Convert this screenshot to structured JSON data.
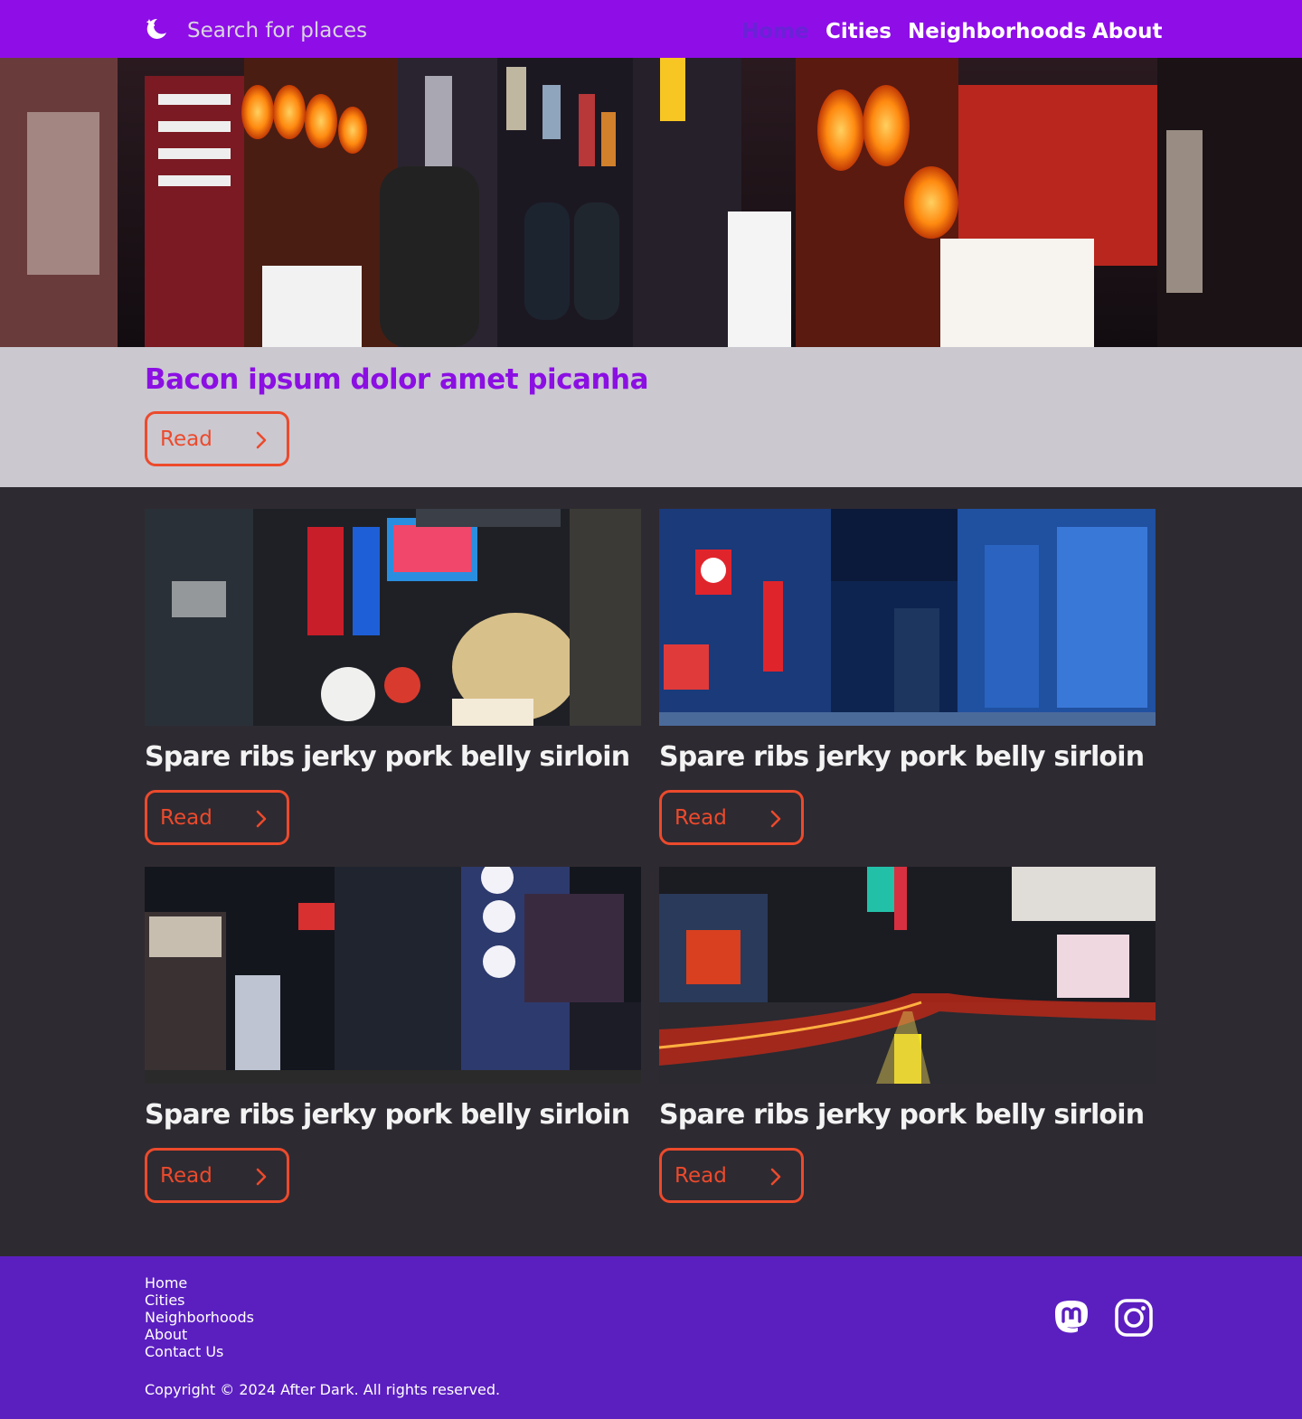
{
  "nav": {
    "search_placeholder": "Search for places",
    "links": [
      "Home",
      "Cities",
      "Neighborhoods",
      "About"
    ]
  },
  "hero": {
    "title": "Bacon ipsum dolor amet picanha",
    "button_label": "Read"
  },
  "cards": [
    {
      "title": "Spare ribs jerky pork belly sirloin",
      "button_label": "Read"
    },
    {
      "title": "Spare ribs jerky pork belly sirloin",
      "button_label": "Read"
    },
    {
      "title": "Spare ribs jerky pork belly sirloin",
      "button_label": "Read"
    },
    {
      "title": "Spare ribs jerky pork belly sirloin",
      "button_label": "Read"
    }
  ],
  "footer": {
    "links": [
      "Home",
      "Cities",
      "Neighborhoods",
      "About",
      "Contact Us"
    ],
    "copyright": "Copyright © 2024 After Dark. All rights reserved.",
    "social": [
      "mastodon-icon",
      "instagram-icon"
    ]
  },
  "colors": {
    "nav_bg": "#8f0ee8",
    "accent_orange": "#ec4a2c",
    "hero_title": "#8b0fe3",
    "page_bg": "#2e2a31",
    "footer_bg": "#5b1fc0",
    "hero_band": "#cbc8d0"
  }
}
